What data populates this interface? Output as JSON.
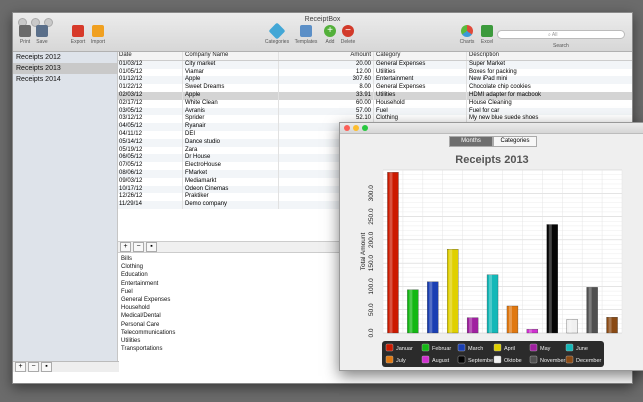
{
  "window": {
    "title": "ReceiptBox"
  },
  "toolbar": {
    "print": {
      "label": "Print",
      "icon": "printer-icon",
      "color": "#6a6a6a"
    },
    "save": {
      "label": "Save",
      "icon": "floppy-icon",
      "color": "#5a6f8a"
    },
    "export": {
      "label": "Export",
      "icon": "pdf-icon",
      "color": "#d73a2a"
    },
    "import": {
      "label": "Import",
      "icon": "doc-icon",
      "color": "#f0a020"
    },
    "categories": {
      "label": "Categories",
      "icon": "tag-icon",
      "color": "#43a7d6"
    },
    "templates": {
      "label": "Templates",
      "icon": "stack-icon",
      "color": "#5b8fc7"
    },
    "add": {
      "label": "Add",
      "icon": "plus-icon",
      "color": "#53b03a"
    },
    "delete": {
      "label": "Delete",
      "icon": "minus-icon",
      "color": "#d23a2a"
    },
    "charts": {
      "label": "Charts",
      "icon": "pie-icon",
      "color": "#e04a3a"
    },
    "excel": {
      "label": "Excel",
      "icon": "excel-icon",
      "color": "#3c9a3c"
    },
    "search": {
      "label": "Search",
      "placeholder": "All"
    }
  },
  "sidebar": {
    "items": [
      "Receipts 2012",
      "Receipts 2013",
      "Receipts 2014"
    ],
    "selected": 1
  },
  "table": {
    "headers": {
      "date": "Date",
      "company": "Company Name",
      "amount": "Amount",
      "category": "Category",
      "description": "Description"
    },
    "rows": [
      {
        "date": "01/03/12",
        "company": "City market",
        "amount": "20.00",
        "category": "General Expenses",
        "description": "Super Market"
      },
      {
        "date": "01/05/12",
        "company": "Viamar",
        "amount": "12.00",
        "category": "Utilities",
        "description": "Boxes for packing"
      },
      {
        "date": "01/12/12",
        "company": "Apple",
        "amount": "307.60",
        "category": "Entertainment",
        "description": "New iPad mini"
      },
      {
        "date": "01/22/12",
        "company": "Sweet Dreams",
        "amount": "8.00",
        "category": "General Expenses",
        "description": "Chocolate chip cookies"
      },
      {
        "date": "02/03/12",
        "company": "Apple",
        "amount": "33.91",
        "category": "Utilities",
        "description": "HDMI adapter for macbook"
      },
      {
        "date": "02/17/12",
        "company": "White Clean",
        "amount": "60.00",
        "category": "Household",
        "description": "House Cleaning"
      },
      {
        "date": "03/05/12",
        "company": "Avranis",
        "amount": "57.00",
        "category": "Fuel",
        "description": "Fuel for car"
      },
      {
        "date": "03/12/12",
        "company": "Sprider",
        "amount": "52.10",
        "category": "Clothing",
        "description": "My new blue suede shoes"
      },
      {
        "date": "04/05/12",
        "company": "Ryanair",
        "amount": "",
        "category": "",
        "description": ""
      },
      {
        "date": "04/11/12",
        "company": "DEI",
        "amount": "",
        "category": "",
        "description": ""
      },
      {
        "date": "05/14/12",
        "company": "Dance studio",
        "amount": "",
        "category": "",
        "description": ""
      },
      {
        "date": "05/19/12",
        "company": "Zara",
        "amount": "",
        "category": "",
        "description": ""
      },
      {
        "date": "06/05/12",
        "company": "Dr House",
        "amount": "",
        "category": "",
        "description": ""
      },
      {
        "date": "07/05/12",
        "company": "ElectroHouse",
        "amount": "",
        "category": "",
        "description": ""
      },
      {
        "date": "08/06/12",
        "company": "FMarket",
        "amount": "",
        "category": "",
        "description": ""
      },
      {
        "date": "09/03/12",
        "company": "Mediamarkt",
        "amount": "",
        "category": "",
        "description": ""
      },
      {
        "date": "10/17/12",
        "company": "Odeon Cinemas",
        "amount": "",
        "category": "",
        "description": ""
      },
      {
        "date": "12/26/12",
        "company": "Praktiker",
        "amount": "",
        "category": "",
        "description": ""
      },
      {
        "date": "11/29/14",
        "company": "Demo company",
        "amount": "",
        "category": "",
        "description": ""
      }
    ],
    "selected_row": 4
  },
  "categories": [
    "Bills",
    "Clothing",
    "Education",
    "Entertainment",
    "Fuel",
    "General Expenses",
    "Household",
    "Medical/Dental",
    "Personal Care",
    "Telecommunications",
    "Utilities",
    "Transportations"
  ],
  "chart_window": {
    "tabs": [
      "Months",
      "Categories"
    ],
    "active_tab": 0
  },
  "chart_data": {
    "type": "bar",
    "title": "Receipts 2013",
    "ylabel": "Total Amount",
    "ylim": [
      0,
      350
    ],
    "yticks": [
      "0.0",
      "50.0",
      "100.0",
      "150.0",
      "200.0",
      "250.0",
      "300.0"
    ],
    "grid": true,
    "legend": "bottom",
    "series": [
      {
        "name": "Januar",
        "value": 345,
        "color": "#cc1a00"
      },
      {
        "name": "Februar",
        "value": 93,
        "color": "#14b814"
      },
      {
        "name": "March",
        "value": 110,
        "color": "#1a3fb3"
      },
      {
        "name": "April",
        "value": 180,
        "color": "#e0d000"
      },
      {
        "name": "May",
        "value": 33,
        "color": "#a020a0"
      },
      {
        "name": "June",
        "value": 125,
        "color": "#14b8b8"
      },
      {
        "name": "July",
        "value": 58,
        "color": "#e07810"
      },
      {
        "name": "August",
        "value": 8,
        "color": "#d030d0"
      },
      {
        "name": "Septembe",
        "value": 233,
        "color": "#050505"
      },
      {
        "name": "Oktobe",
        "value": 29,
        "color": "#f0f0f0"
      },
      {
        "name": "November",
        "value": 98,
        "color": "#505050"
      },
      {
        "name": "December",
        "value": 34,
        "color": "#8a4a14"
      }
    ]
  }
}
